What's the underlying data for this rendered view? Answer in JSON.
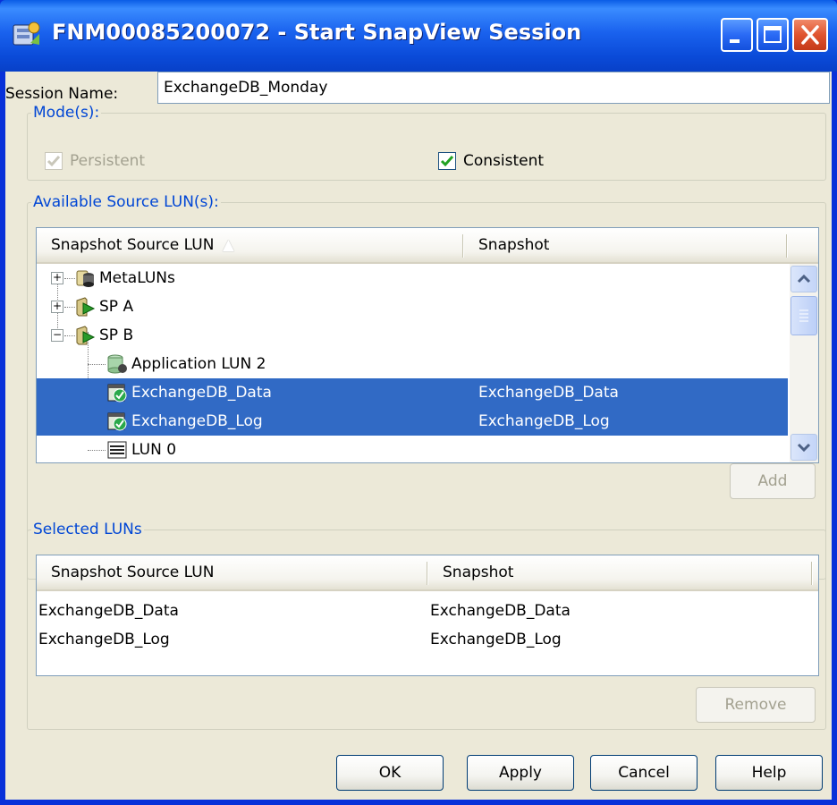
{
  "window": {
    "title": "FNM00085200072 - Start SnapView Session",
    "icon": "snapview-app-icon",
    "controls": {
      "minimize": "minimize-icon",
      "maximize": "maximize-icon",
      "close": "close-icon"
    }
  },
  "session": {
    "label": "Session Name:",
    "value": "ExchangeDB_Monday"
  },
  "modes": {
    "legend": "Mode(s):",
    "persistent": {
      "label": "Persistent",
      "checked": true,
      "enabled": false
    },
    "consistent": {
      "label": "Consistent",
      "checked": true,
      "enabled": true
    }
  },
  "available": {
    "legend": "Available Source LUN(s):",
    "columns": [
      "Snapshot Source LUN",
      "Snapshot"
    ],
    "sort_indicator": "▲",
    "tree": [
      {
        "label": "MetaLUNs",
        "snapshot": "",
        "icon": "metalun-icon",
        "expander": "+",
        "selected": false
      },
      {
        "label": "SP A",
        "snapshot": "",
        "icon": "storage-processor-icon",
        "expander": "+",
        "selected": false
      },
      {
        "label": "SP B",
        "snapshot": "",
        "icon": "storage-processor-icon",
        "expander": "−",
        "selected": false
      },
      {
        "label": "Application LUN 2",
        "snapshot": "",
        "icon": "lun-icon",
        "expander": "",
        "selected": false
      },
      {
        "label": "ExchangeDB_Data",
        "snapshot": "ExchangeDB_Data",
        "icon": "lun-check-icon",
        "expander": "",
        "selected": true
      },
      {
        "label": "ExchangeDB_Log",
        "snapshot": "ExchangeDB_Log",
        "icon": "lun-check-icon",
        "expander": "",
        "selected": true
      },
      {
        "label": "LUN 0",
        "snapshot": "",
        "icon": "lun-icon",
        "expander": "",
        "selected": false
      }
    ],
    "add_button": "Add"
  },
  "selected": {
    "legend": "Selected LUNs",
    "columns": [
      "Snapshot Source LUN",
      "Snapshot"
    ],
    "rows": [
      {
        "source": "ExchangeDB_Data",
        "snapshot": "ExchangeDB_Data"
      },
      {
        "source": "ExchangeDB_Log",
        "snapshot": "ExchangeDB_Log"
      }
    ],
    "remove_button": "Remove"
  },
  "buttons": {
    "ok": "OK",
    "apply": "Apply",
    "cancel": "Cancel",
    "help": "Help"
  },
  "colors": {
    "selection": "#316ac5",
    "group_legend": "#0046d5",
    "titlebar": "#1a62ee"
  }
}
